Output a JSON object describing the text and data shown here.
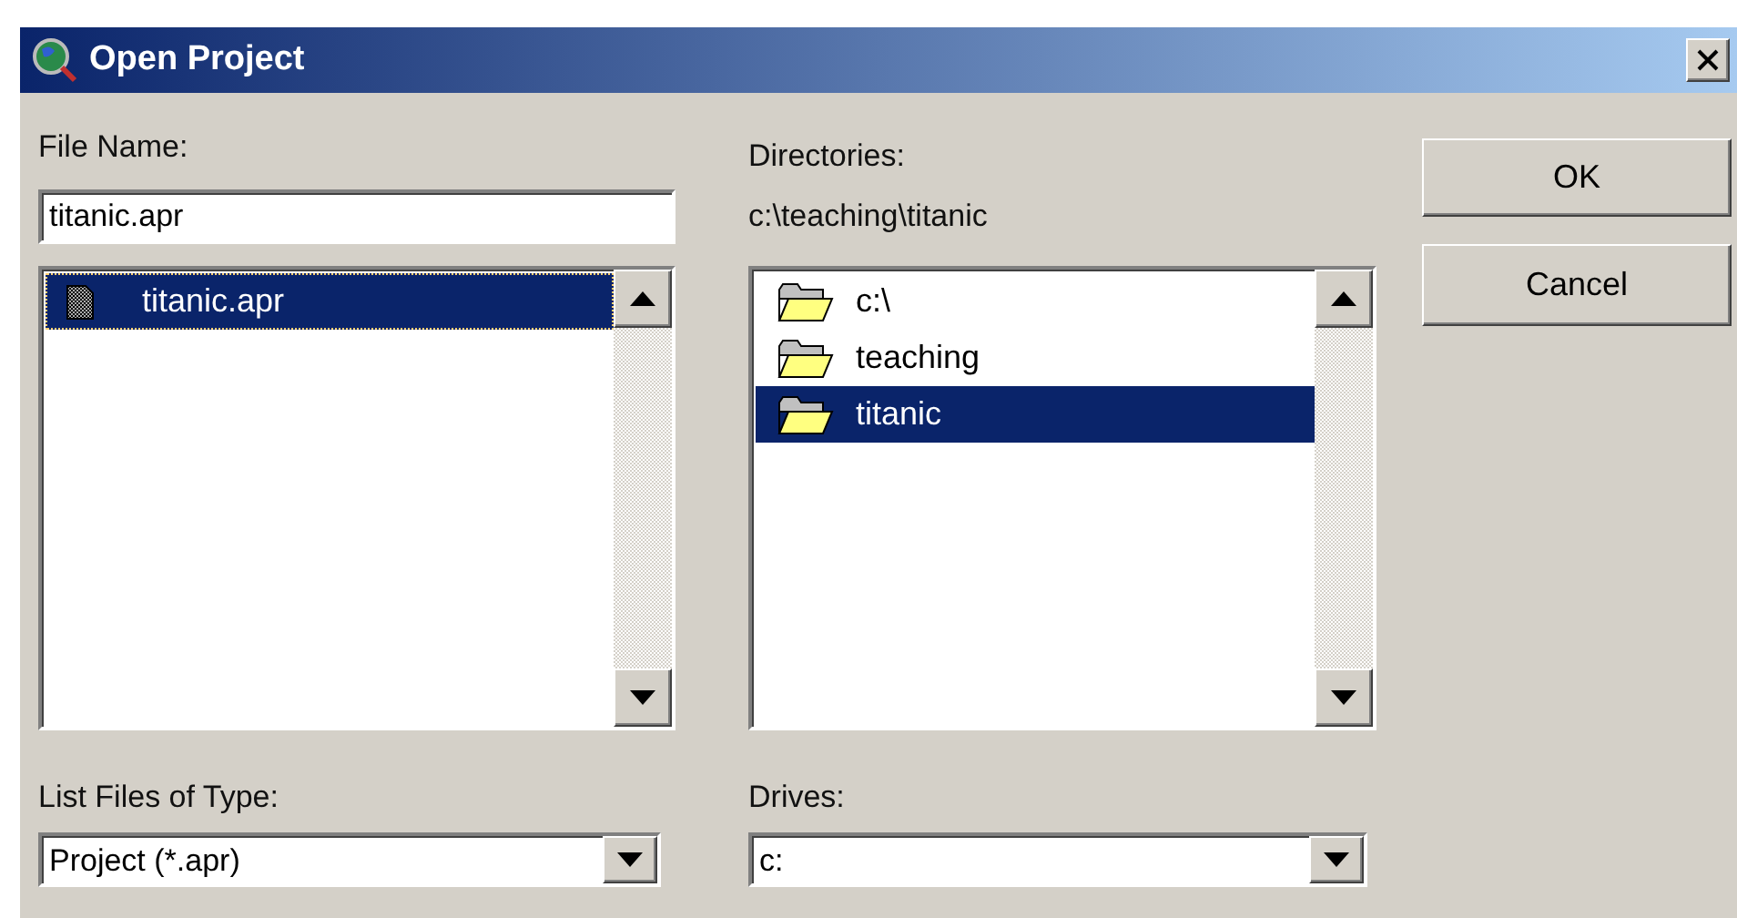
{
  "window": {
    "title": "Open Project"
  },
  "file_name": {
    "label": "File Name:",
    "value": "titanic.apr"
  },
  "files": [
    {
      "name": "titanic.apr",
      "selected": true
    }
  ],
  "directories": {
    "label": "Directories:",
    "path": "c:\\teaching\\titanic",
    "items": [
      {
        "name": "c:\\",
        "selected": false
      },
      {
        "name": "teaching",
        "selected": false
      },
      {
        "name": "titanic",
        "selected": true
      }
    ]
  },
  "file_type": {
    "label": "List Files of Type:",
    "value": "Project (*.apr)"
  },
  "drives": {
    "label": "Drives:",
    "value": "c:"
  },
  "buttons": [
    {
      "label": "OK"
    },
    {
      "label": "Cancel"
    }
  ]
}
